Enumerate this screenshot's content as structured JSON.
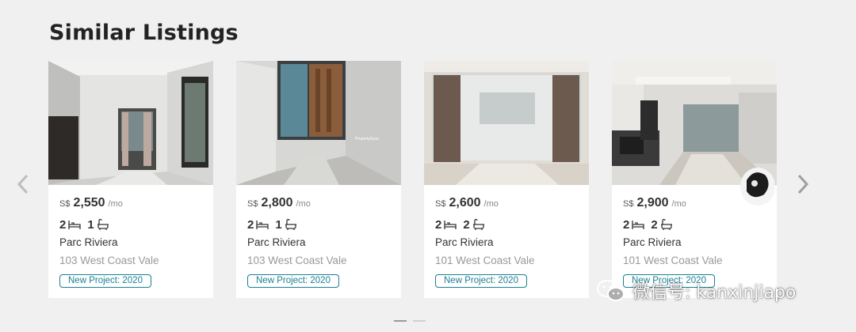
{
  "section": {
    "title": "Similar Listings"
  },
  "carousel": {
    "prev_icon": "chevron-left-icon",
    "next_icon": "chevron-right-icon",
    "dots": [
      {
        "active": true
      },
      {
        "active": false
      }
    ]
  },
  "listings": [
    {
      "currency": "S$",
      "price": "2,550",
      "period": "/mo",
      "beds": "2",
      "baths": "1",
      "project": "Parc Riviera",
      "address": "103 West Coast Vale",
      "tag": "New Project: 2020"
    },
    {
      "currency": "S$",
      "price": "2,800",
      "period": "/mo",
      "beds": "2",
      "baths": "1",
      "project": "Parc Riviera",
      "address": "103 West Coast Vale",
      "tag": "New Project: 2020"
    },
    {
      "currency": "S$",
      "price": "2,600",
      "period": "/mo",
      "beds": "2",
      "baths": "2",
      "project": "Parc Riviera",
      "address": "101 West Coast Vale",
      "tag": "New Project: 2020"
    },
    {
      "currency": "S$",
      "price": "2,900",
      "period": "/mo",
      "beds": "2",
      "baths": "2",
      "project": "Parc Riviera",
      "address": "101 West Coast Vale",
      "tag": "New Project: 2020"
    }
  ],
  "overlay": {
    "watermark": "微信号: kanxinjiapo",
    "icon": "wechat-icon"
  },
  "colors": {
    "accent": "#1a7f93",
    "background": "#f0f0f0"
  }
}
